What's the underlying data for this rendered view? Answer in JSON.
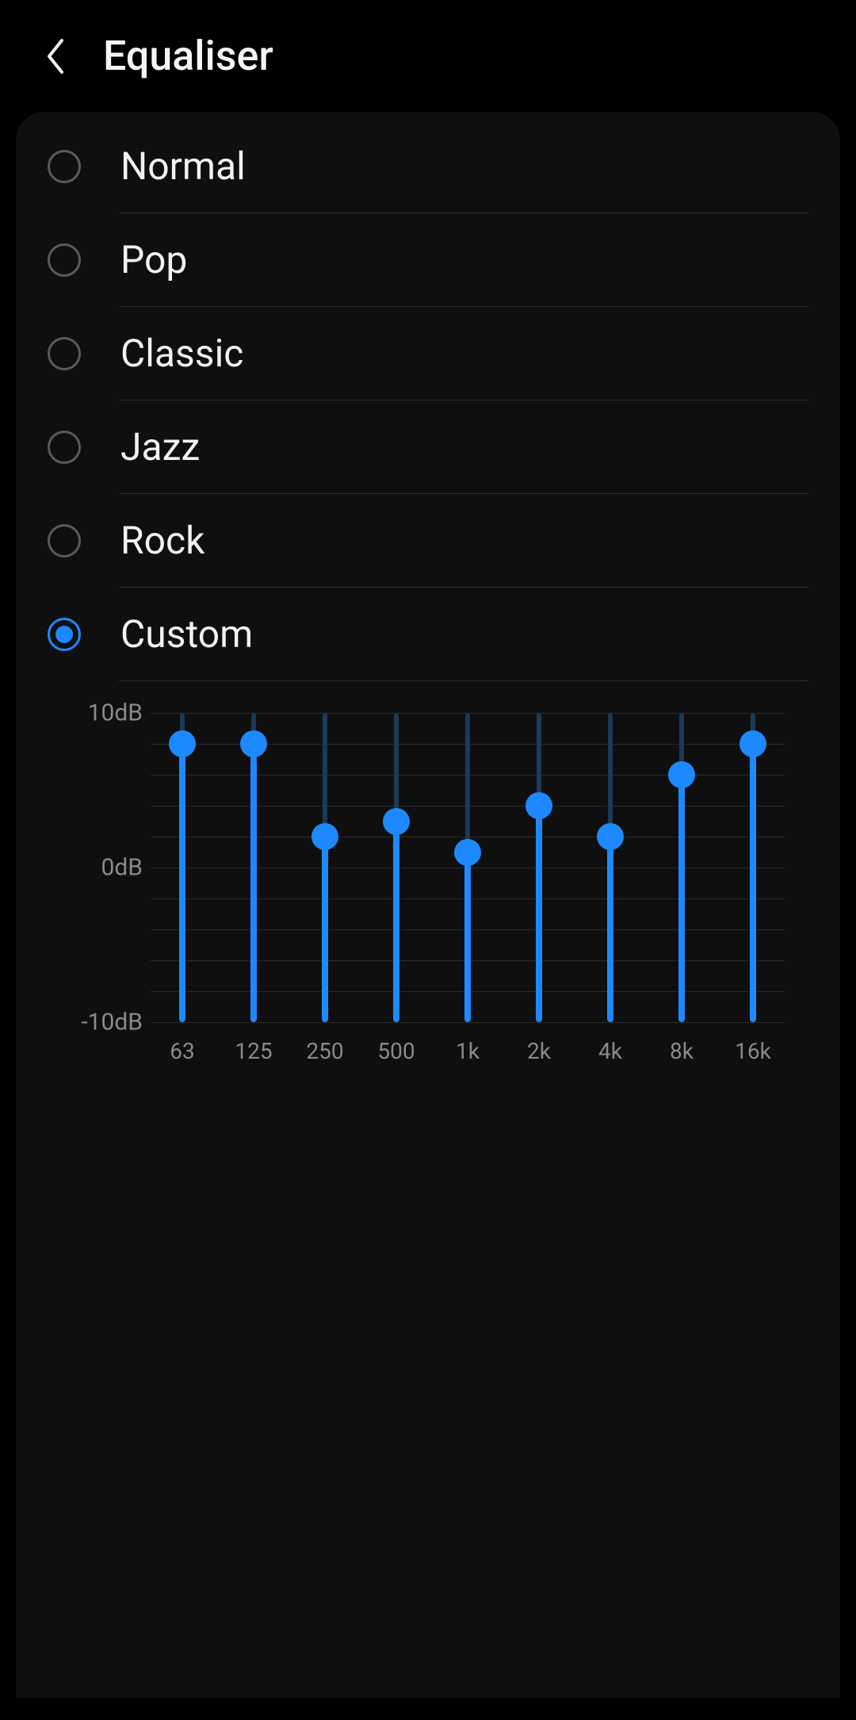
{
  "header": {
    "title": "Equaliser"
  },
  "presets": [
    {
      "label": "Normal",
      "selected": false
    },
    {
      "label": "Pop",
      "selected": false
    },
    {
      "label": "Classic",
      "selected": false
    },
    {
      "label": "Jazz",
      "selected": false
    },
    {
      "label": "Rock",
      "selected": false
    },
    {
      "label": "Custom",
      "selected": true
    }
  ],
  "chart_data": {
    "type": "bar",
    "title": "",
    "xlabel": "",
    "ylabel": "",
    "ylim": [
      -10,
      10
    ],
    "categories": [
      "63",
      "125",
      "250",
      "500",
      "1k",
      "2k",
      "4k",
      "8k",
      "16k"
    ],
    "values": [
      8,
      8,
      2,
      3,
      1,
      4,
      2,
      6,
      8
    ],
    "unit": "dB",
    "y_ticks": [
      {
        "v": 10,
        "label": "10dB"
      },
      {
        "v": 0,
        "label": "0dB"
      },
      {
        "v": -10,
        "label": "-10dB"
      }
    ],
    "gridlines_step": 2
  },
  "colors": {
    "accent": "#1E88FF",
    "background": "#000000",
    "card": "#0f0f0f",
    "muted_text": "#8a8a8a",
    "divider": "#2a2a2a"
  }
}
